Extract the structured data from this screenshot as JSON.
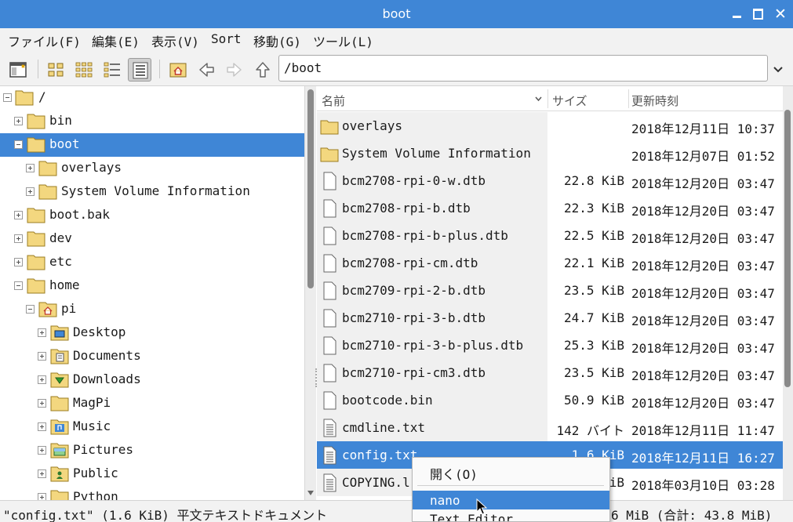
{
  "window": {
    "title": "boot"
  },
  "menu": [
    "ファイル(F)",
    "編集(E)",
    "表示(V)",
    "Sort",
    "移動(G)",
    "ツール(L)"
  ],
  "location": {
    "path": "/boot"
  },
  "tree": [
    {
      "label": "/"
    },
    {
      "label": "bin"
    },
    {
      "label": "boot"
    },
    {
      "label": "overlays"
    },
    {
      "label": "System Volume Information"
    },
    {
      "label": "boot.bak"
    },
    {
      "label": "dev"
    },
    {
      "label": "etc"
    },
    {
      "label": "home"
    },
    {
      "label": "pi"
    },
    {
      "label": "Desktop"
    },
    {
      "label": "Documents"
    },
    {
      "label": "Downloads"
    },
    {
      "label": "MagPi"
    },
    {
      "label": "Music"
    },
    {
      "label": "Pictures"
    },
    {
      "label": "Public"
    },
    {
      "label": "Python"
    }
  ],
  "columns": {
    "name": "名前",
    "size": "サイズ",
    "modified": "更新時刻"
  },
  "files": [
    {
      "name": "overlays",
      "size": "",
      "modified": "2018年12月11日 10:37"
    },
    {
      "name": "System Volume Information",
      "size": "",
      "modified": "2018年12月07日 01:52"
    },
    {
      "name": "bcm2708-rpi-0-w.dtb",
      "size": "22.8 KiB",
      "modified": "2018年12月20日 03:47"
    },
    {
      "name": "bcm2708-rpi-b.dtb",
      "size": "22.3 KiB",
      "modified": "2018年12月20日 03:47"
    },
    {
      "name": "bcm2708-rpi-b-plus.dtb",
      "size": "22.5 KiB",
      "modified": "2018年12月20日 03:47"
    },
    {
      "name": "bcm2708-rpi-cm.dtb",
      "size": "22.1 KiB",
      "modified": "2018年12月20日 03:47"
    },
    {
      "name": "bcm2709-rpi-2-b.dtb",
      "size": "23.5 KiB",
      "modified": "2018年12月20日 03:47"
    },
    {
      "name": "bcm2710-rpi-3-b.dtb",
      "size": "24.7 KiB",
      "modified": "2018年12月20日 03:47"
    },
    {
      "name": "bcm2710-rpi-3-b-plus.dtb",
      "size": "25.3 KiB",
      "modified": "2018年12月20日 03:47"
    },
    {
      "name": "bcm2710-rpi-cm3.dtb",
      "size": "23.5 KiB",
      "modified": "2018年12月20日 03:47"
    },
    {
      "name": "bootcode.bin",
      "size": "50.9 KiB",
      "modified": "2018年12月20日 03:47"
    },
    {
      "name": "cmdline.txt",
      "size": "142 バイト",
      "modified": "2018年12月11日 11:47"
    },
    {
      "name": "config.txt",
      "size": "1.6 KiB",
      "modified": "2018年12月11日 16:27"
    },
    {
      "name": "COPYING.l",
      "size": "iB",
      "modified": "2018年03月10日 03:28"
    }
  ],
  "status": {
    "left": "\"config.txt\" (1.6 KiB) 平文テキストドキュメント",
    "right": "6 MiB (合計: 43.8 MiB)"
  },
  "context_menu": {
    "open": "開く(O)",
    "nano": "nano",
    "text_editor": "Text Editor"
  },
  "colors": {
    "accent": "#3f86d6",
    "folder": "#f3d77f"
  }
}
